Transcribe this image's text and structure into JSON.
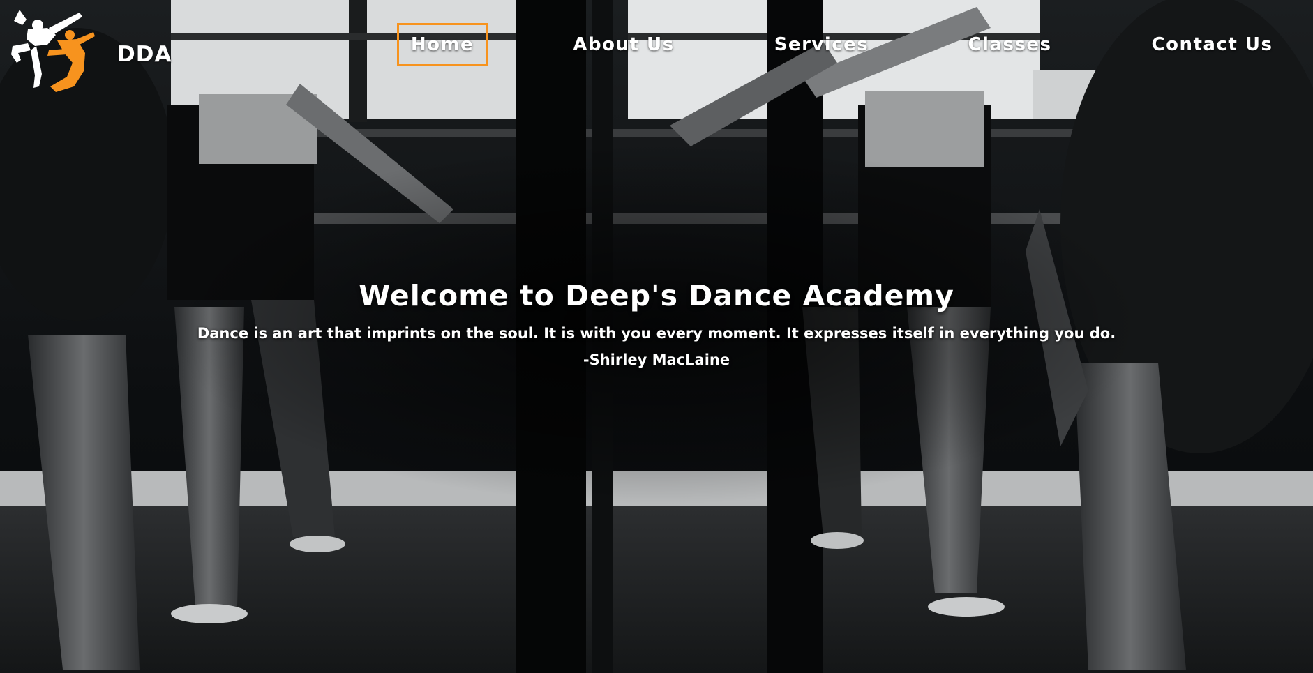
{
  "brand": {
    "name": "DDA",
    "logo_icon": "dancer-silhouette-icon",
    "accent_color": "#f7931e"
  },
  "nav": {
    "items": [
      {
        "label": "Home",
        "active": true
      },
      {
        "label": "About Us",
        "active": false
      },
      {
        "label": "Services",
        "active": false
      },
      {
        "label": "Classes",
        "active": false
      },
      {
        "label": "Contact Us",
        "active": false
      }
    ]
  },
  "hero": {
    "title": "Welcome to Deep's Dance Academy",
    "quote": "Dance is an art that imprints on the soul. It is with you every moment. It expresses itself in everything you do.",
    "author": "-Shirley MacLaine",
    "background_image": "black-and-white ballet dancers practicing at barre"
  }
}
